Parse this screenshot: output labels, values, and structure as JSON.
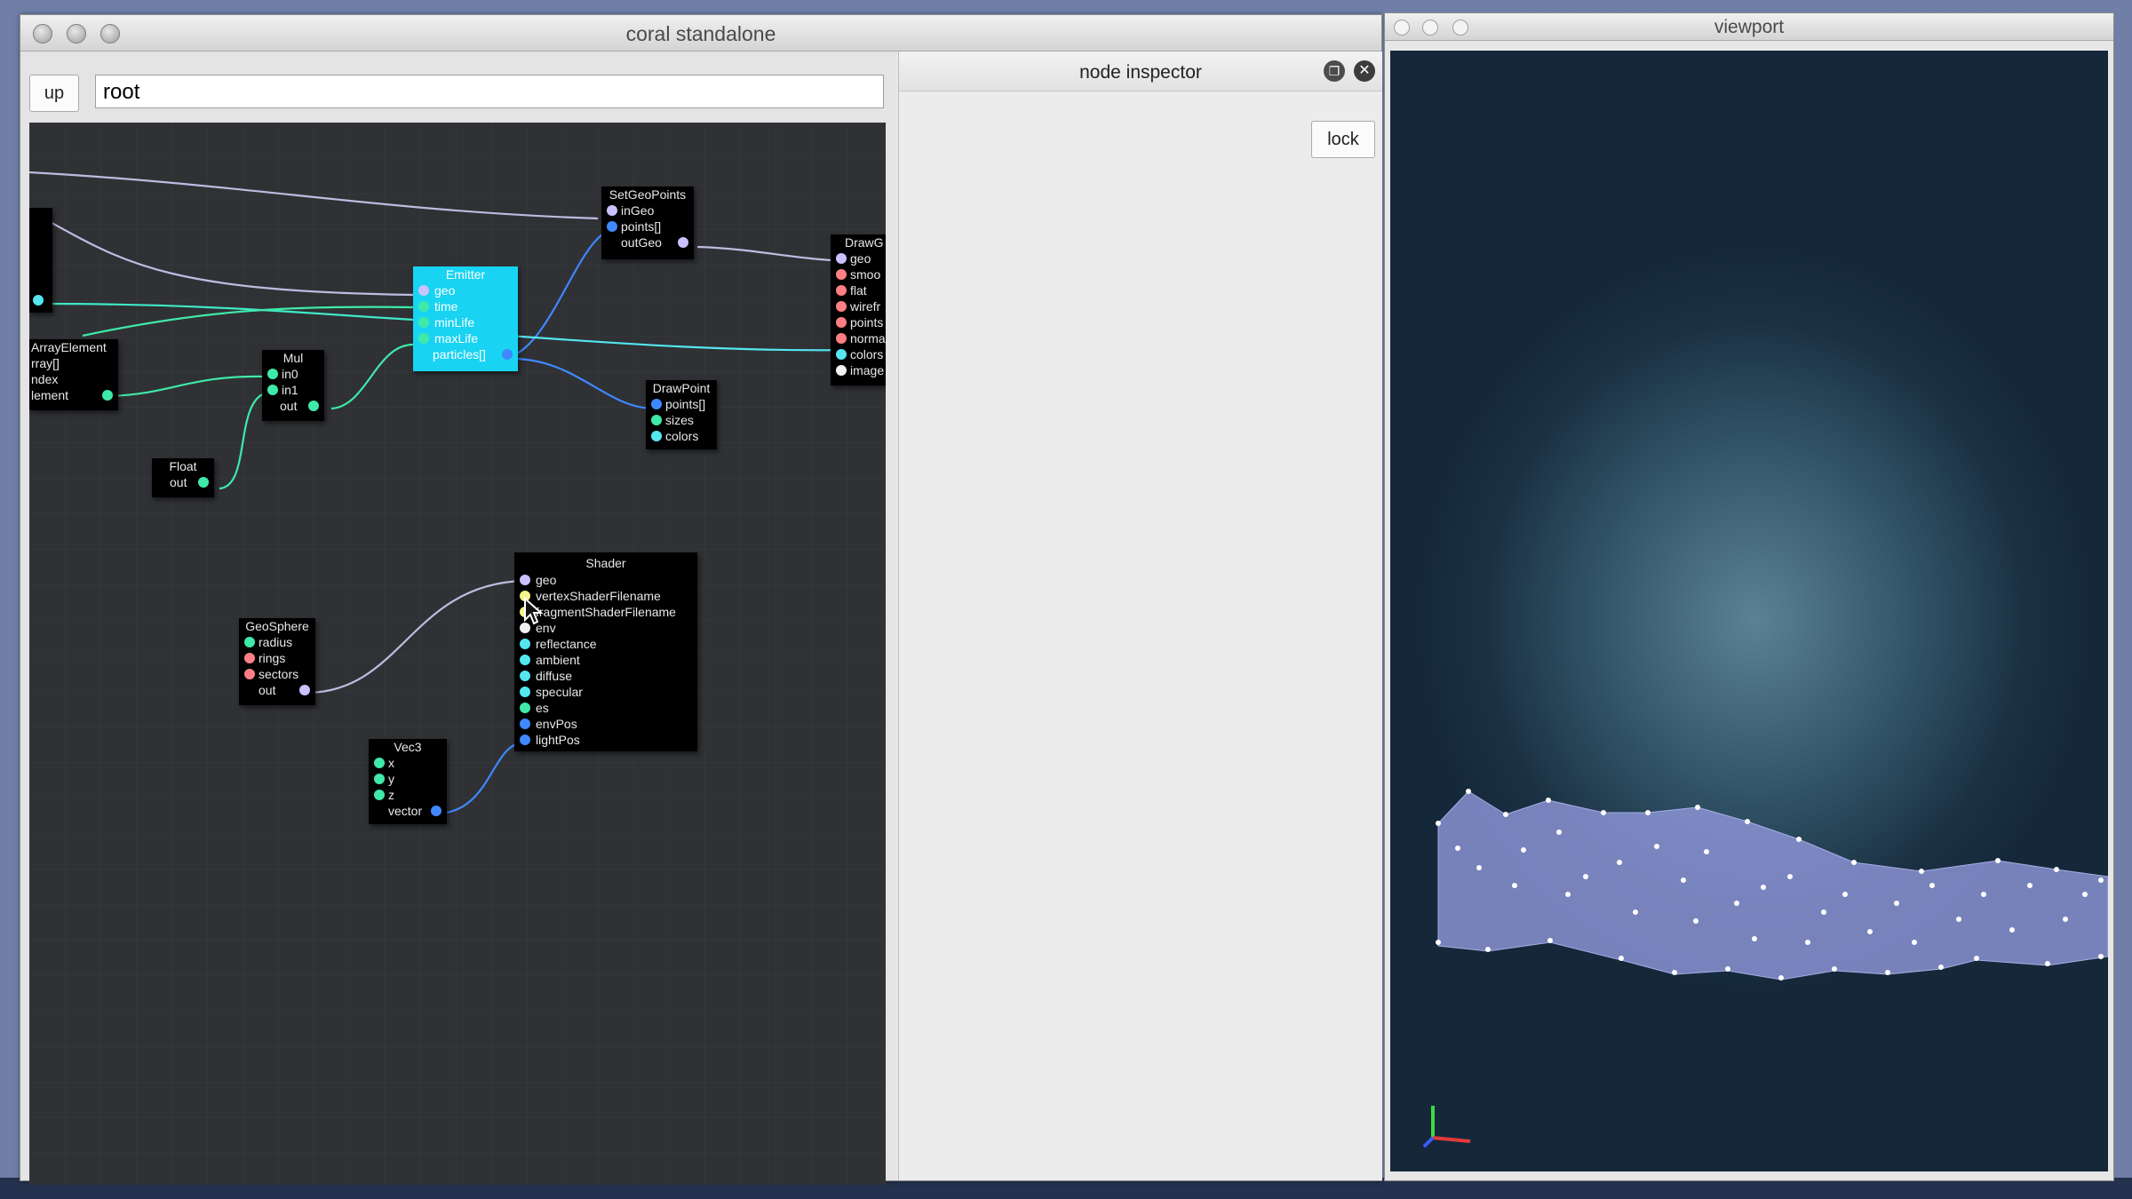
{
  "main_window": {
    "title": "coral standalone",
    "up_label": "up",
    "path_value": "root"
  },
  "nodes": {
    "setgeopoints": {
      "title": "SetGeoPoints",
      "ports": [
        "inGeo",
        "points[]",
        "outGeo"
      ]
    },
    "drawgeo": {
      "title": "DrawG",
      "ports": [
        "geo",
        "smoo",
        "flat",
        "wirefr",
        "points",
        "norma",
        "colors",
        "image"
      ]
    },
    "emitter": {
      "title": "Emitter",
      "ports": [
        "geo",
        "time",
        "minLife",
        "maxLife",
        "particles[]"
      ]
    },
    "arrayelement": {
      "title": "ArrayElement",
      "ports": [
        "rray[]",
        "ndex",
        "lement"
      ]
    },
    "mul": {
      "title": "Mul",
      "ports": [
        "in0",
        "in1",
        "out"
      ]
    },
    "drawpoint": {
      "title": "DrawPoint",
      "ports": [
        "points[]",
        "sizes",
        "colors"
      ]
    },
    "float": {
      "title": "Float",
      "ports": [
        "out"
      ]
    },
    "shader": {
      "title": "Shader",
      "ports": [
        "geo",
        "vertexShaderFilename",
        "fragmentShaderFilename",
        "env",
        "reflectance",
        "ambient",
        "diffuse",
        "specular",
        "es",
        "envPos",
        "lightPos"
      ]
    },
    "geosphere": {
      "title": "GeoSphere",
      "ports": [
        "radius",
        "rings",
        "sectors",
        "out"
      ]
    },
    "vec3": {
      "title": "Vec3",
      "ports": [
        "x",
        "y",
        "z",
        "vector"
      ]
    }
  },
  "inspector": {
    "title": "node inspector",
    "lock_label": "lock"
  },
  "viewport_window": {
    "title": "viewport"
  },
  "colors": {
    "canvas_bg": "#2f3135",
    "active_node": "#19d3f2",
    "port_geo": "#c9c2ff",
    "port_float": "#3fe9a8",
    "port_int": "#ff7f86",
    "port_vec": "#3f88ff",
    "port_string": "#f5f58a",
    "port_cyan": "#55e6f0",
    "axis_x": "#e23a3a",
    "axis_y": "#3ddb3d",
    "axis_z": "#3a5cff"
  },
  "icons": [
    "close-icon",
    "float-window-icon",
    "mouse-pointer-icon",
    "axis-gizmo-icon"
  ]
}
